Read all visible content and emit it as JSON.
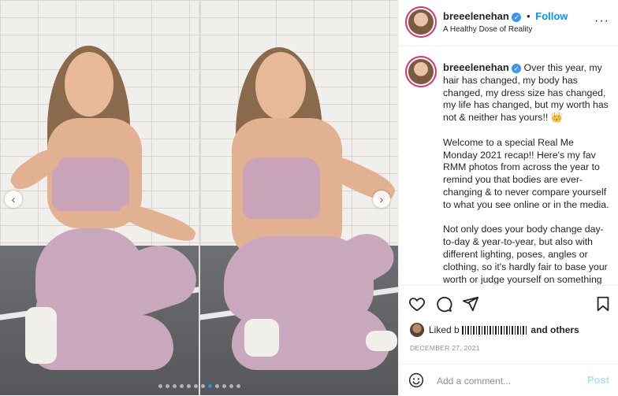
{
  "post": {
    "username": "breeelenehan",
    "verified_symbol": "✓",
    "separator": "•",
    "follow_label": "Follow",
    "subtitle": "A Healthy Dose of Reality",
    "more_label": "···"
  },
  "caption": {
    "username": "breeelenehan",
    "p1": "Over this year, my hair has changed, my body has changed, my dress size has changed, my life has changed, but my worth has not & neither has yours!!",
    "p1_emoji": "👑",
    "p2": "Welcome to a special Real Me Monday 2021 recap!! Here's my fav RMM photos from across the year to remind you that bodies are ever-changing & to never compare yourself to what you see online or in the media.",
    "p3": "Not only does your body change day-to-day & year-to-year, but also with different lighting, poses, angles or clothing, so it's hardly fair to base your worth or judge yourself on something as fickle & everchanging as your body."
  },
  "likes": {
    "prefix": "Liked b",
    "suffix": "and others"
  },
  "date": "DECEMBER 27, 2021",
  "comment_box": {
    "placeholder": "Add a comment...",
    "post_label": "Post"
  },
  "carousel": {
    "prev_symbol": "‹",
    "next_symbol": "›",
    "dot_count": 12,
    "active_index": 7
  },
  "colors": {
    "accent": "#0095f6",
    "verified": "#3897f0",
    "active_dot": "#1e90ff"
  }
}
